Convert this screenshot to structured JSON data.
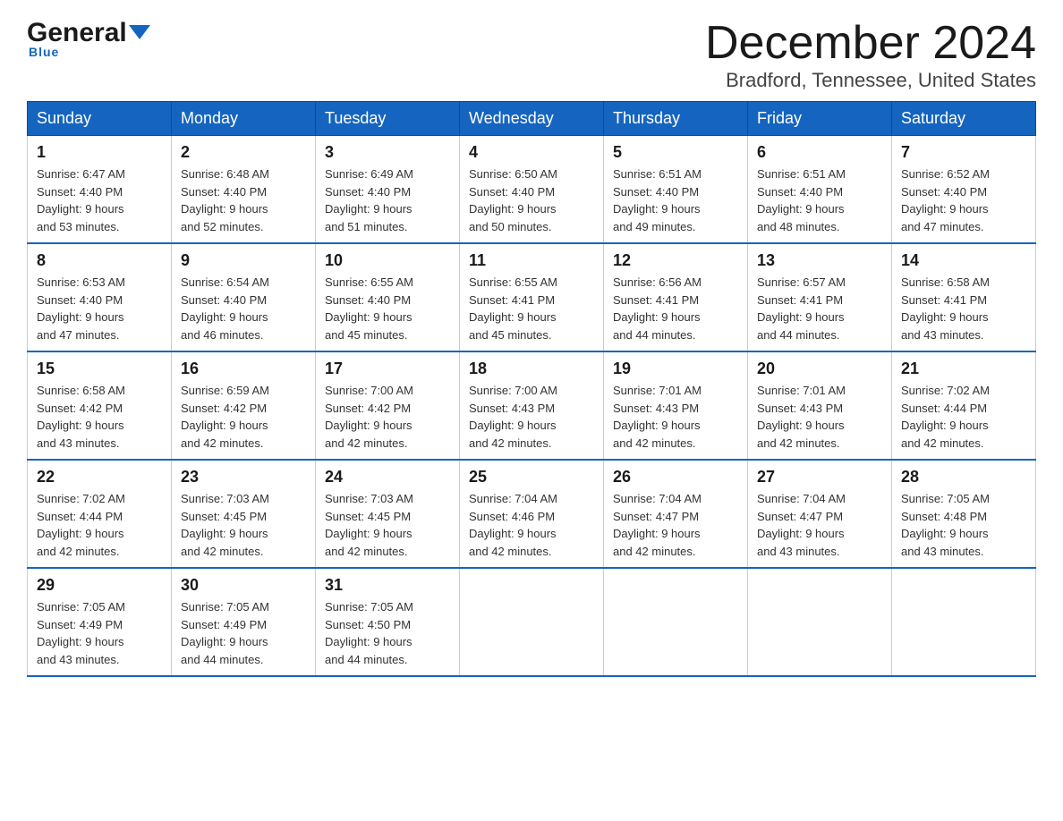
{
  "header": {
    "logo_general": "General",
    "logo_blue": "Blue",
    "month_title": "December 2024",
    "location": "Bradford, Tennessee, United States"
  },
  "weekdays": [
    "Sunday",
    "Monday",
    "Tuesday",
    "Wednesday",
    "Thursday",
    "Friday",
    "Saturday"
  ],
  "weeks": [
    [
      {
        "day": "1",
        "sunrise": "6:47 AM",
        "sunset": "4:40 PM",
        "daylight_hours": "9 hours",
        "daylight_minutes": "and 53 minutes."
      },
      {
        "day": "2",
        "sunrise": "6:48 AM",
        "sunset": "4:40 PM",
        "daylight_hours": "9 hours",
        "daylight_minutes": "and 52 minutes."
      },
      {
        "day": "3",
        "sunrise": "6:49 AM",
        "sunset": "4:40 PM",
        "daylight_hours": "9 hours",
        "daylight_minutes": "and 51 minutes."
      },
      {
        "day": "4",
        "sunrise": "6:50 AM",
        "sunset": "4:40 PM",
        "daylight_hours": "9 hours",
        "daylight_minutes": "and 50 minutes."
      },
      {
        "day": "5",
        "sunrise": "6:51 AM",
        "sunset": "4:40 PM",
        "daylight_hours": "9 hours",
        "daylight_minutes": "and 49 minutes."
      },
      {
        "day": "6",
        "sunrise": "6:51 AM",
        "sunset": "4:40 PM",
        "daylight_hours": "9 hours",
        "daylight_minutes": "and 48 minutes."
      },
      {
        "day": "7",
        "sunrise": "6:52 AM",
        "sunset": "4:40 PM",
        "daylight_hours": "9 hours",
        "daylight_minutes": "and 47 minutes."
      }
    ],
    [
      {
        "day": "8",
        "sunrise": "6:53 AM",
        "sunset": "4:40 PM",
        "daylight_hours": "9 hours",
        "daylight_minutes": "and 47 minutes."
      },
      {
        "day": "9",
        "sunrise": "6:54 AM",
        "sunset": "4:40 PM",
        "daylight_hours": "9 hours",
        "daylight_minutes": "and 46 minutes."
      },
      {
        "day": "10",
        "sunrise": "6:55 AM",
        "sunset": "4:40 PM",
        "daylight_hours": "9 hours",
        "daylight_minutes": "and 45 minutes."
      },
      {
        "day": "11",
        "sunrise": "6:55 AM",
        "sunset": "4:41 PM",
        "daylight_hours": "9 hours",
        "daylight_minutes": "and 45 minutes."
      },
      {
        "day": "12",
        "sunrise": "6:56 AM",
        "sunset": "4:41 PM",
        "daylight_hours": "9 hours",
        "daylight_minutes": "and 44 minutes."
      },
      {
        "day": "13",
        "sunrise": "6:57 AM",
        "sunset": "4:41 PM",
        "daylight_hours": "9 hours",
        "daylight_minutes": "and 44 minutes."
      },
      {
        "day": "14",
        "sunrise": "6:58 AM",
        "sunset": "4:41 PM",
        "daylight_hours": "9 hours",
        "daylight_minutes": "and 43 minutes."
      }
    ],
    [
      {
        "day": "15",
        "sunrise": "6:58 AM",
        "sunset": "4:42 PM",
        "daylight_hours": "9 hours",
        "daylight_minutes": "and 43 minutes."
      },
      {
        "day": "16",
        "sunrise": "6:59 AM",
        "sunset": "4:42 PM",
        "daylight_hours": "9 hours",
        "daylight_minutes": "and 42 minutes."
      },
      {
        "day": "17",
        "sunrise": "7:00 AM",
        "sunset": "4:42 PM",
        "daylight_hours": "9 hours",
        "daylight_minutes": "and 42 minutes."
      },
      {
        "day": "18",
        "sunrise": "7:00 AM",
        "sunset": "4:43 PM",
        "daylight_hours": "9 hours",
        "daylight_minutes": "and 42 minutes."
      },
      {
        "day": "19",
        "sunrise": "7:01 AM",
        "sunset": "4:43 PM",
        "daylight_hours": "9 hours",
        "daylight_minutes": "and 42 minutes."
      },
      {
        "day": "20",
        "sunrise": "7:01 AM",
        "sunset": "4:43 PM",
        "daylight_hours": "9 hours",
        "daylight_minutes": "and 42 minutes."
      },
      {
        "day": "21",
        "sunrise": "7:02 AM",
        "sunset": "4:44 PM",
        "daylight_hours": "9 hours",
        "daylight_minutes": "and 42 minutes."
      }
    ],
    [
      {
        "day": "22",
        "sunrise": "7:02 AM",
        "sunset": "4:44 PM",
        "daylight_hours": "9 hours",
        "daylight_minutes": "and 42 minutes."
      },
      {
        "day": "23",
        "sunrise": "7:03 AM",
        "sunset": "4:45 PM",
        "daylight_hours": "9 hours",
        "daylight_minutes": "and 42 minutes."
      },
      {
        "day": "24",
        "sunrise": "7:03 AM",
        "sunset": "4:45 PM",
        "daylight_hours": "9 hours",
        "daylight_minutes": "and 42 minutes."
      },
      {
        "day": "25",
        "sunrise": "7:04 AM",
        "sunset": "4:46 PM",
        "daylight_hours": "9 hours",
        "daylight_minutes": "and 42 minutes."
      },
      {
        "day": "26",
        "sunrise": "7:04 AM",
        "sunset": "4:47 PM",
        "daylight_hours": "9 hours",
        "daylight_minutes": "and 42 minutes."
      },
      {
        "day": "27",
        "sunrise": "7:04 AM",
        "sunset": "4:47 PM",
        "daylight_hours": "9 hours",
        "daylight_minutes": "and 43 minutes."
      },
      {
        "day": "28",
        "sunrise": "7:05 AM",
        "sunset": "4:48 PM",
        "daylight_hours": "9 hours",
        "daylight_minutes": "and 43 minutes."
      }
    ],
    [
      {
        "day": "29",
        "sunrise": "7:05 AM",
        "sunset": "4:49 PM",
        "daylight_hours": "9 hours",
        "daylight_minutes": "and 43 minutes."
      },
      {
        "day": "30",
        "sunrise": "7:05 AM",
        "sunset": "4:49 PM",
        "daylight_hours": "9 hours",
        "daylight_minutes": "and 44 minutes."
      },
      {
        "day": "31",
        "sunrise": "7:05 AM",
        "sunset": "4:50 PM",
        "daylight_hours": "9 hours",
        "daylight_minutes": "and 44 minutes."
      },
      null,
      null,
      null,
      null
    ]
  ]
}
